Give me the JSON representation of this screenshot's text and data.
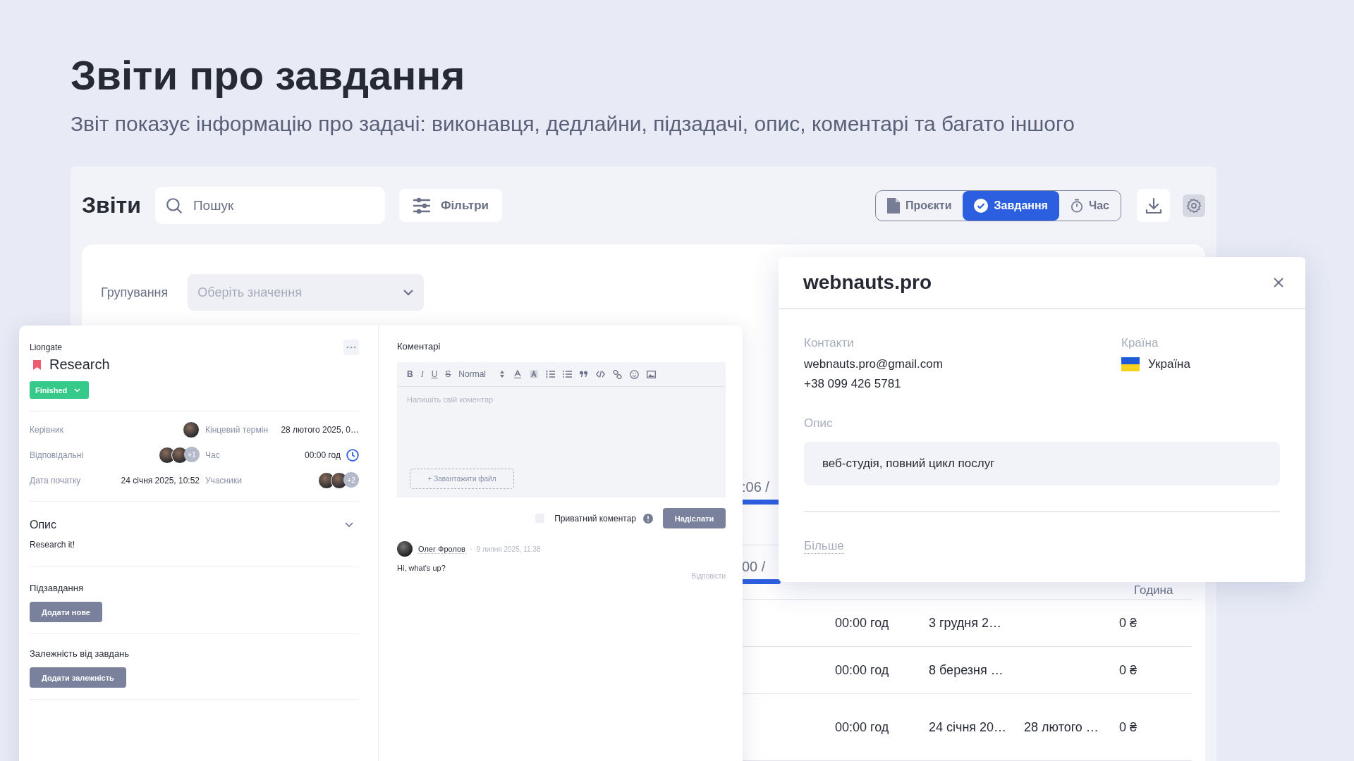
{
  "page": {
    "title": "Звіти про завдання",
    "subtitle": "Звіт показує інформацію про задачі: виконавця, дедлайни, підзадачі, опис, коментарі та багато іншого"
  },
  "toolbar": {
    "title": "Звіти",
    "search": {
      "placeholder": "Пошук"
    },
    "filters_button": "Фільтри",
    "views": [
      {
        "label": "Проєкти",
        "kind": "file",
        "selected": false
      },
      {
        "label": "Завдання",
        "kind": "check",
        "selected": true
      },
      {
        "label": "Час",
        "kind": "timer",
        "selected": false
      }
    ]
  },
  "grouping": {
    "label": "Групування",
    "select": {
      "placeholder": "Оберіть значення"
    }
  },
  "table": {
    "fragments": [
      ":06 /",
      "00 /"
    ],
    "header": "Година",
    "rows": [
      {
        "time": "00:00 год",
        "start": "3 грудня 2…",
        "price": "0 ₴"
      },
      {
        "time": "00:00 год",
        "start": "8 березня …",
        "price": "0 ₴"
      },
      {
        "time": "00:00 год",
        "start": "24 січня 20…",
        "end": "28 лютого …",
        "price": "0 ₴"
      }
    ]
  },
  "task": {
    "project": "Liongate",
    "title": "Research",
    "status": "Finished",
    "fields": [
      {
        "label": "Керівник",
        "kind": "avatars",
        "avatars": [
          {
            "kind": "photo"
          }
        ]
      },
      {
        "label": "Кінцевий термін",
        "kind": "text",
        "value": "28 лютого 2025, 0…"
      },
      {
        "label": "Відповідальні",
        "kind": "avatars",
        "avatars": [
          {
            "kind": "photo"
          },
          {
            "kind": "photo"
          }
        ],
        "extra": "+1"
      },
      {
        "label": "Час",
        "kind": "time",
        "value": "00:00 год"
      },
      {
        "label": "Дата початку",
        "kind": "text",
        "value": "24 січня 2025, 10:52"
      },
      {
        "label": "Учасники",
        "kind": "avatars",
        "avatars": [
          {
            "kind": "photo"
          },
          {
            "kind": "photo"
          }
        ],
        "extra": "+2"
      }
    ],
    "description": {
      "heading": "Опис",
      "expanded": true,
      "text": "Research it!"
    },
    "subtasks": {
      "heading": "Підзавдання",
      "button": "Додати нове"
    },
    "dependencies": {
      "heading": "Залежність від завдань",
      "button": "Додати залежність"
    }
  },
  "comments": {
    "heading": "Коментарі",
    "editor": {
      "tools": [
        {
          "kind": "bold",
          "label": "B"
        },
        {
          "kind": "italic",
          "label": "I"
        },
        {
          "kind": "underline",
          "label": "U"
        },
        {
          "kind": "strike",
          "label": "S"
        },
        {
          "kind": "select",
          "label": "Normal"
        },
        {
          "kind": "color"
        },
        {
          "kind": "background"
        },
        {
          "kind": "ordered"
        },
        {
          "kind": "bullet"
        },
        {
          "kind": "quote"
        },
        {
          "kind": "code"
        },
        {
          "kind": "link"
        },
        {
          "kind": "emoji"
        },
        {
          "kind": "image"
        }
      ],
      "placeholder": "Напишіть свій коментар",
      "upload": "+ Завантажити файл"
    },
    "private": {
      "label": "Приватний коментар",
      "checked": false
    },
    "send": "Надіслати",
    "items": [
      {
        "author": "Олег Фролов",
        "separator": "·",
        "date": "9 липня 2025, 11:38",
        "text": "Hi, what's up?",
        "reply": "Відповісти"
      }
    ]
  },
  "company": {
    "title": "webnauts.pro",
    "contacts_label": "Контакти",
    "contacts": [
      "webnauts.pro@gmail.com",
      "+38 099 426 5781"
    ],
    "country_label": "Країна",
    "country": "Україна",
    "description_label": "Опис",
    "description": "веб-студія, повний цикл послуг",
    "more": "Більше"
  }
}
